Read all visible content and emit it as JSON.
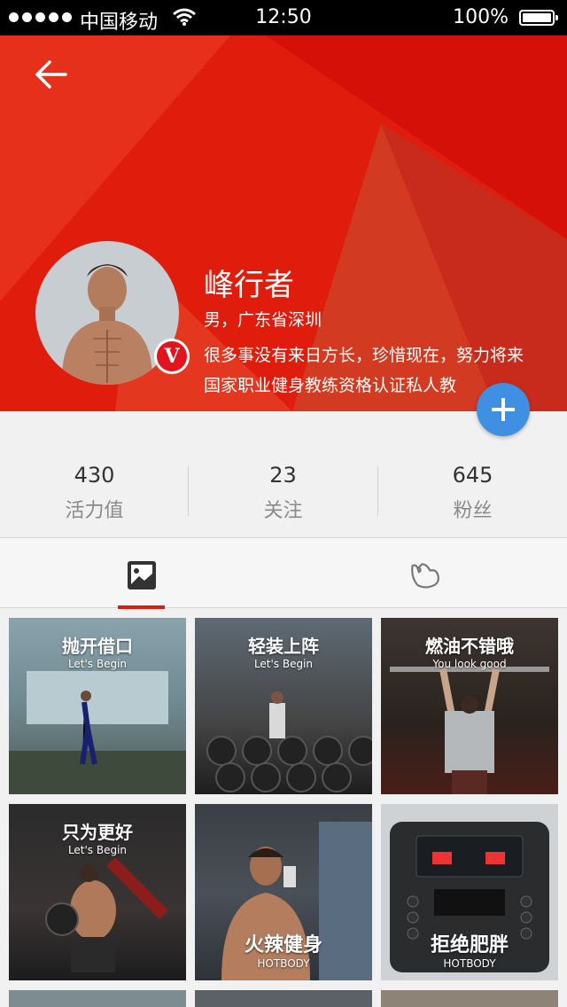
{
  "status_bar": {
    "carrier": "中国移动",
    "time": "12:50",
    "battery": "100%"
  },
  "profile": {
    "name": "峰行者",
    "location": "男，广东省深圳",
    "bio": "很多事没有来日方长，珍惜现在，努力将来",
    "title": "国家职业健身教练资格认证私人教",
    "verified_badge": "V",
    "brand_color": "#e01c0d",
    "fab_color": "#3f8fe3"
  },
  "stats": [
    {
      "value": "430",
      "label": "活力值"
    },
    {
      "value": "23",
      "label": "关注"
    },
    {
      "value": "645",
      "label": "粉丝"
    }
  ],
  "tabs": [
    {
      "icon": "photo-icon",
      "active": true
    },
    {
      "icon": "muscle-arm-icon",
      "active": false
    }
  ],
  "posts": [
    {
      "overlay": "抛开借口",
      "sub": "Let's Begin",
      "position": "top"
    },
    {
      "overlay": "轻装上阵",
      "sub": "Let's Begin",
      "position": "top"
    },
    {
      "overlay": "燃油不错哦",
      "sub": "You look good",
      "position": "top"
    },
    {
      "overlay": "只为更好",
      "sub": "Let's Begin",
      "position": "top"
    },
    {
      "overlay": "火辣健身",
      "sub": "HOTBODY",
      "position": "bottom"
    },
    {
      "overlay": "拒绝肥胖",
      "sub": "HOTBODY",
      "position": "bottom"
    }
  ]
}
